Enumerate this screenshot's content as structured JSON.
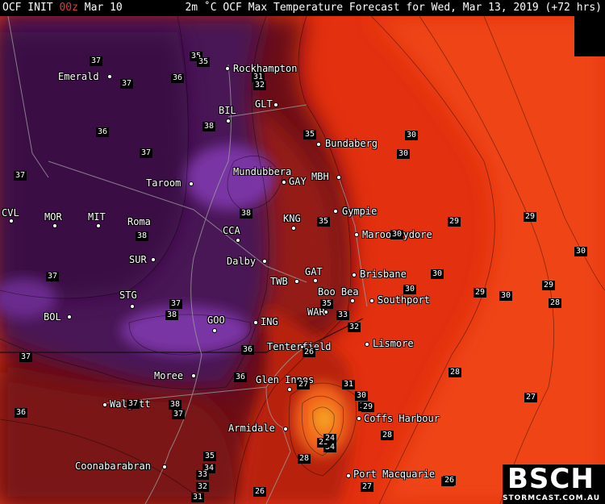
{
  "header": {
    "model": "OCF INIT",
    "init_time": "00z",
    "init_date": "Mar 10",
    "title": "2m ˚C OCF Max Temperature Forecast for Wed, Mar 13, 2019 (+72 hrs)"
  },
  "logo": {
    "text": "BSCH",
    "subtext": "STORMCAST.COM.AU"
  },
  "colors": {
    "purple_deep": "#3a0a45",
    "purple": "#5a1f72",
    "violet": "#7a35a5",
    "maroon": "#5a0b10",
    "brick": "#8a1a12",
    "red": "#d92a10",
    "red_orange": "#ef3b10",
    "orange": "#f2661a",
    "yellow_orange": "#f5a024"
  },
  "places": [
    {
      "id": "rockhampton",
      "name": "Rockhampton"
    },
    {
      "id": "emerald",
      "name": "Emerald"
    },
    {
      "id": "bil",
      "name": "BIL"
    },
    {
      "id": "glt",
      "name": "GLT"
    },
    {
      "id": "bundaberg",
      "name": "Bundaberg"
    },
    {
      "id": "taroom",
      "name": "Taroom"
    },
    {
      "id": "mundubbera",
      "name": "Mundubbera"
    },
    {
      "id": "mbh",
      "name": "MBH"
    },
    {
      "id": "gay",
      "name": "GAY"
    },
    {
      "id": "cvl",
      "name": "CVL"
    },
    {
      "id": "mor",
      "name": "MOR"
    },
    {
      "id": "mit",
      "name": "MIT"
    },
    {
      "id": "roma",
      "name": "Roma"
    },
    {
      "id": "kng",
      "name": "KNG"
    },
    {
      "id": "gympie",
      "name": "Gympie"
    },
    {
      "id": "cca",
      "name": "CCA"
    },
    {
      "id": "maroochydore",
      "name": "Maroochydore"
    },
    {
      "id": "sur",
      "name": "SUR"
    },
    {
      "id": "dalby",
      "name": "Dalby"
    },
    {
      "id": "gat",
      "name": "GAT"
    },
    {
      "id": "brisbane",
      "name": "Brisbane"
    },
    {
      "id": "twb",
      "name": "TWB"
    },
    {
      "id": "boobea",
      "name": "Boo Bea"
    },
    {
      "id": "stg",
      "name": "STG"
    },
    {
      "id": "southport",
      "name": "Southport"
    },
    {
      "id": "war",
      "name": "WAR"
    },
    {
      "id": "bol",
      "name": "BOL"
    },
    {
      "id": "goo",
      "name": "GOO"
    },
    {
      "id": "ing",
      "name": "ING"
    },
    {
      "id": "lismore",
      "name": "Lismore"
    },
    {
      "id": "tenterfield",
      "name": "Tenterfield"
    },
    {
      "id": "moree",
      "name": "Moree"
    },
    {
      "id": "glen_innes",
      "name": "Glen Innes"
    },
    {
      "id": "walgett",
      "name": "Walgett"
    },
    {
      "id": "coffs_harbour",
      "name": "Coffs Harbour"
    },
    {
      "id": "armidale",
      "name": "Armidale"
    },
    {
      "id": "coonabarabran",
      "name": "Coonabarabran"
    },
    {
      "id": "port_macquarie",
      "name": "Port Macquarie"
    }
  ],
  "contour_labels": [
    "37",
    "37",
    "36",
    "35",
    "35",
    "31",
    "32",
    "36",
    "38",
    "37",
    "37",
    "35",
    "30",
    "30",
    "38",
    "37",
    "38",
    "35",
    "29",
    "29",
    "30",
    "38",
    "30",
    "37",
    "30",
    "30",
    "29",
    "30",
    "29",
    "28",
    "37",
    "38",
    "35",
    "33",
    "37",
    "36",
    "32",
    "26",
    "36",
    "28",
    "37",
    "36",
    "27",
    "28",
    "31",
    "30",
    "27",
    "32",
    "34",
    "29",
    "25",
    "24",
    "28",
    "35",
    "34",
    "28",
    "33",
    "32",
    "26",
    "27",
    "26",
    "31"
  ]
}
